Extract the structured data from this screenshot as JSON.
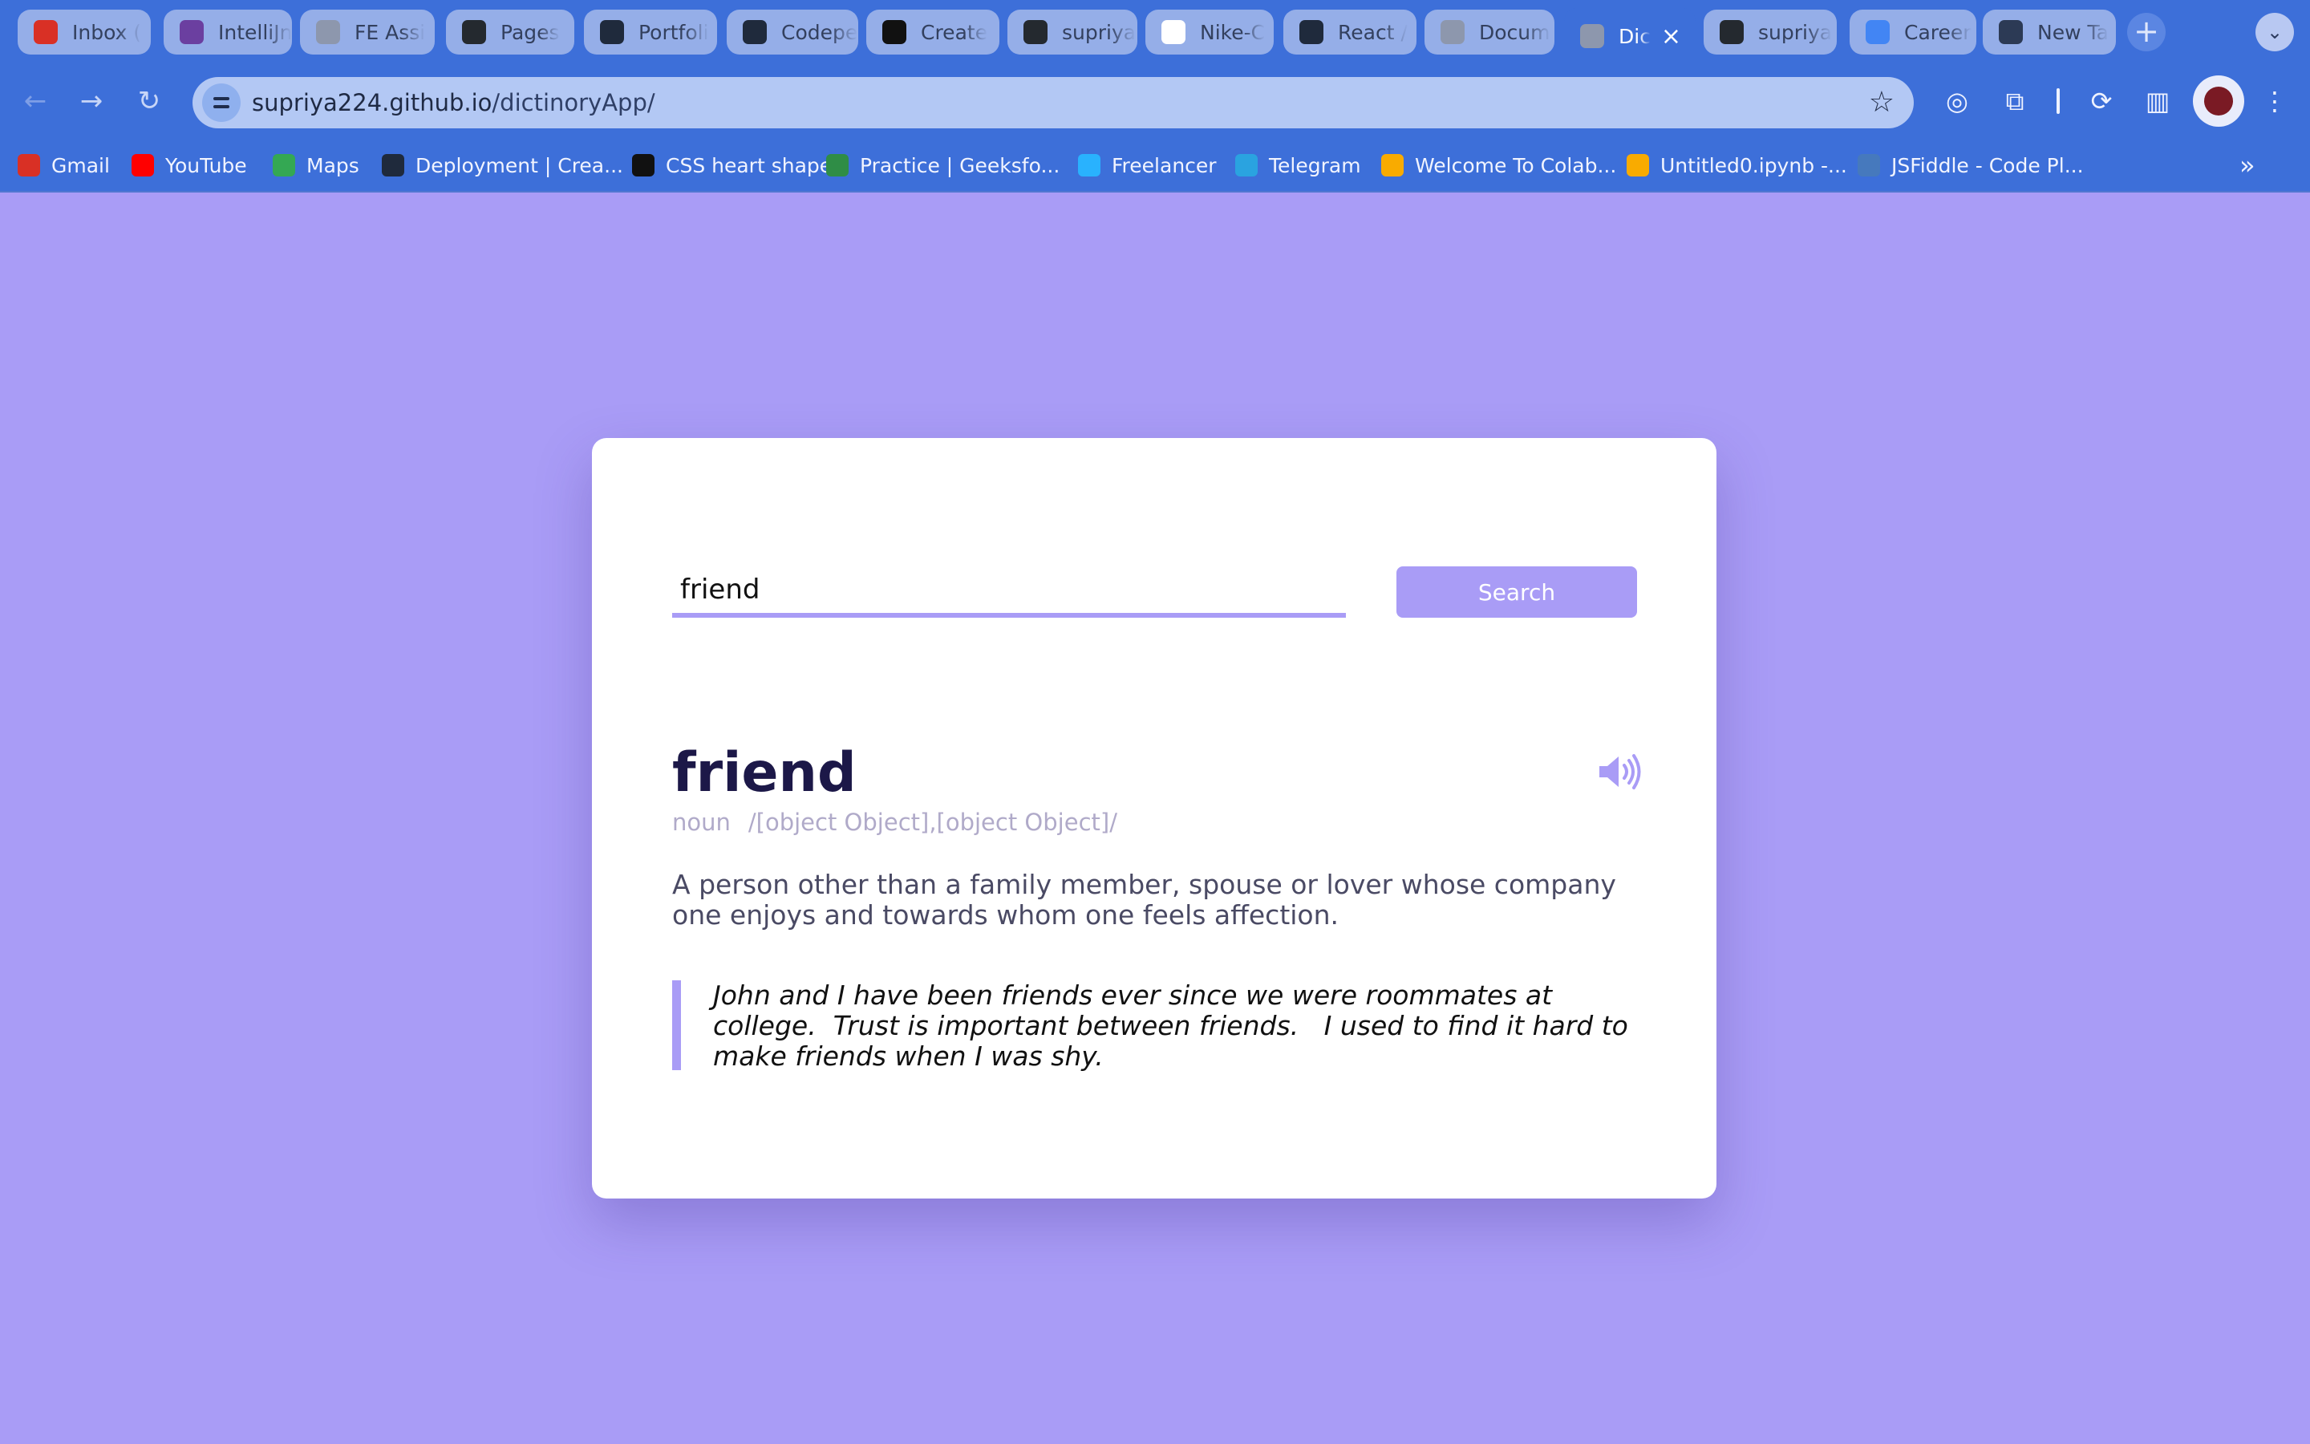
{
  "browser": {
    "tabs": [
      {
        "title": "Inbox (",
        "icon": "gmail-icon",
        "color": "#d93025"
      },
      {
        "title": "IntelliJn",
        "icon": "intellij-icon",
        "color": "#6b3fa0"
      },
      {
        "title": "FE Assi",
        "icon": "globe-icon",
        "color": "#8d97ad"
      },
      {
        "title": "Pages",
        "icon": "github-icon",
        "color": "#24292f"
      },
      {
        "title": "Portfoli",
        "icon": "react-icon",
        "color": "#1f2a3c"
      },
      {
        "title": "Codepe",
        "icon": "react-icon",
        "color": "#1f2a3c"
      },
      {
        "title": "Create",
        "icon": "vercel-icon",
        "color": "#111111"
      },
      {
        "title": "supriya",
        "icon": "github-icon",
        "color": "#24292f"
      },
      {
        "title": "Nike-C",
        "icon": "nike-icon",
        "color": "#ffffff"
      },
      {
        "title": "React /",
        "icon": "react-icon",
        "color": "#1f2a3c"
      },
      {
        "title": "Docum",
        "icon": "globe-icon",
        "color": "#8d97ad"
      },
      {
        "title": "Dic",
        "icon": "globe-icon",
        "color": "#8d97ad",
        "active": true
      },
      {
        "title": "supriya",
        "icon": "github-icon",
        "color": "#24292f"
      },
      {
        "title": "Career",
        "icon": "google-icon",
        "color": "#4285f4"
      },
      {
        "title": "New Ta",
        "icon": "chrome-icon",
        "color": "#2c3a55"
      }
    ],
    "new_tab_label": "+",
    "tab_menu_label": "⌄",
    "url_host": "supriya224.github.io",
    "url_path": "/dictinoryApp/"
  },
  "bookmarks": [
    {
      "label": "Gmail",
      "icon": "gmail-icon",
      "color": "#d93025"
    },
    {
      "label": "YouTube",
      "icon": "youtube-icon",
      "color": "#ff0000"
    },
    {
      "label": "Maps",
      "icon": "maps-icon",
      "color": "#34a853"
    },
    {
      "label": "Deployment | Crea...",
      "icon": "react-icon",
      "color": "#1f2a3c"
    },
    {
      "label": "CSS heart shape",
      "icon": "codepen-icon",
      "color": "#111111"
    },
    {
      "label": "Practice | Geeksfo...",
      "icon": "geeksforgeeks-icon",
      "color": "#2f8d46"
    },
    {
      "label": "Freelancer",
      "icon": "freelancer-icon",
      "color": "#29b2fe"
    },
    {
      "label": "Telegram",
      "icon": "telegram-icon",
      "color": "#2aa3e0"
    },
    {
      "label": "Welcome To Colab...",
      "icon": "colab-icon",
      "color": "#f9ab00"
    },
    {
      "label": "Untitled0.ipynb -...",
      "icon": "colab-icon",
      "color": "#f9ab00"
    },
    {
      "label": "JSFiddle - Code Pl...",
      "icon": "jsfiddle-icon",
      "color": "#4679bd"
    }
  ],
  "app": {
    "search_value": "friend",
    "search_button": "Search",
    "word": "friend",
    "part_of_speech": "noun",
    "phonetic": "/[object Object],[object Object]/",
    "definition": "A person other than a family member, spouse or lover whose company one enjoys and towards whom one feels affection.",
    "examples": "John and I have been friends ever since we were roommates at college.  Trust is important between friends.   I used to find it hard to make friends when I was shy.",
    "accent_color": "#a99cf6"
  }
}
